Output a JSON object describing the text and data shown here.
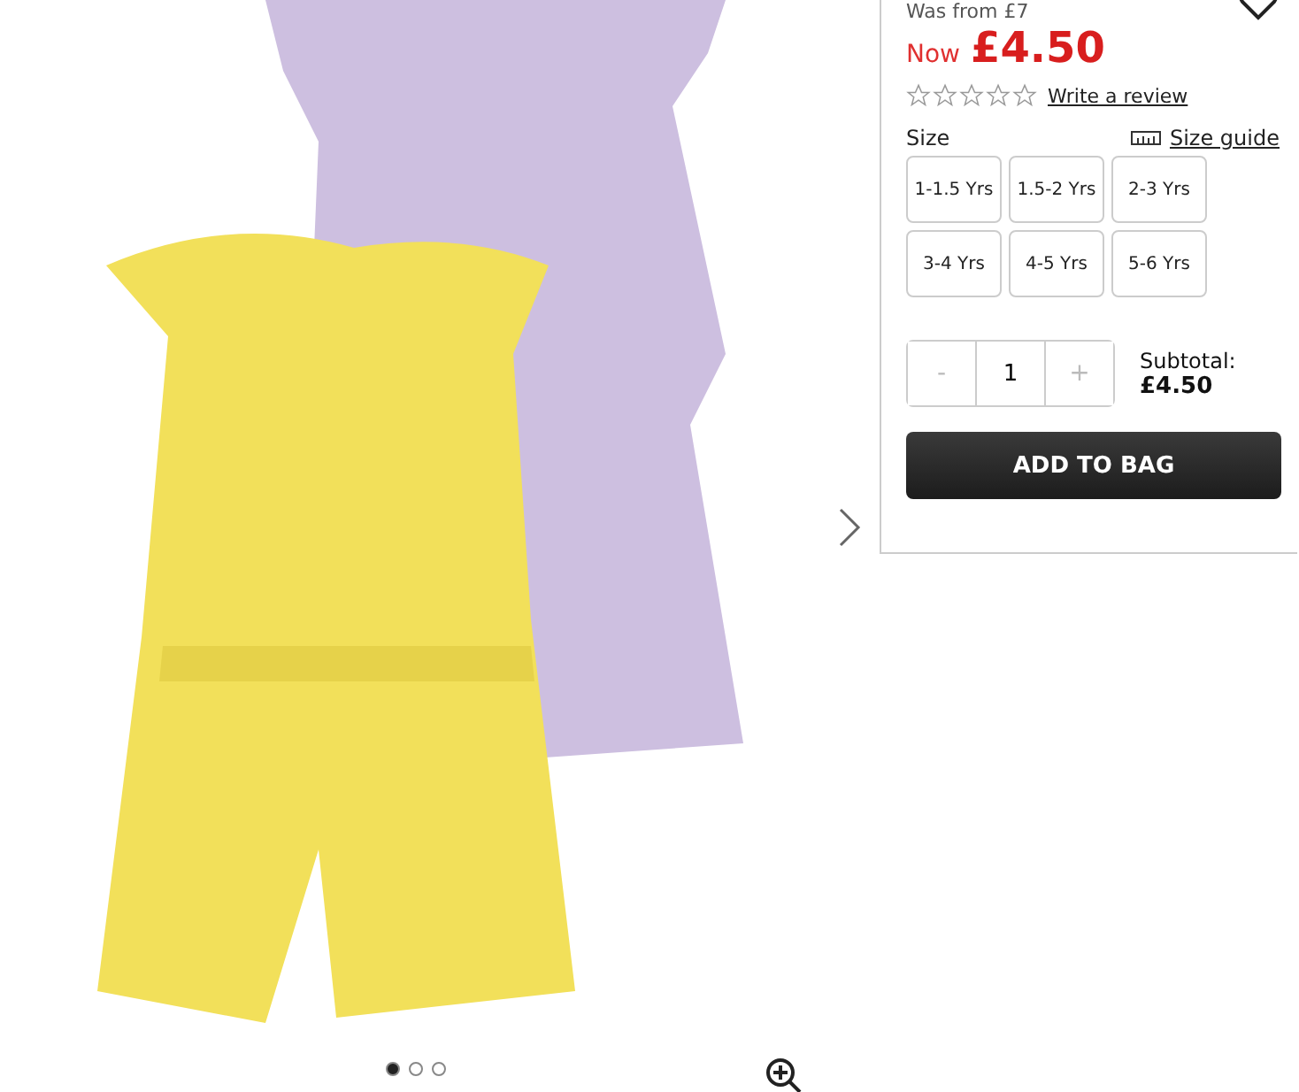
{
  "product": {
    "was_price": "Was from £7",
    "now_label": "Now",
    "now_price": "£4.50",
    "stars": 0,
    "review_link": "Write a review"
  },
  "size": {
    "label": "Size",
    "guide": "Size guide",
    "options": [
      {
        "label": "1-1.5 Yrs",
        "selected": false
      },
      {
        "label": "1.5-2 Yrs",
        "selected": false
      },
      {
        "label": "2-3 Yrs",
        "selected": false
      },
      {
        "label": "3-4 Yrs",
        "selected": false
      },
      {
        "label": "4-5 Yrs",
        "selected": false
      },
      {
        "label": "5-6 Yrs",
        "selected": false
      }
    ]
  },
  "quantity": {
    "minus": "-",
    "value": "1",
    "plus": "+"
  },
  "subtotal": {
    "label": "Subtotal:",
    "value": "£4.50"
  },
  "add_button": "ADD TO BAG",
  "carousel": {
    "dots": [
      {
        "selected": true
      },
      {
        "selected": false
      },
      {
        "selected": false
      }
    ]
  }
}
